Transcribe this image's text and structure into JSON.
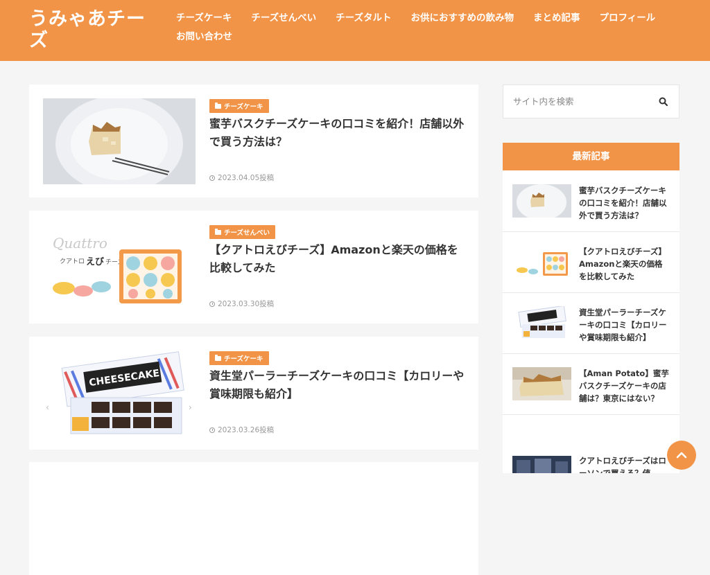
{
  "header": {
    "site_title": "うみゃあチーズ",
    "nav": [
      "チーズケーキ",
      "チーズせんべい",
      "チーズタルト",
      "お供におすすめの飲み物",
      "まとめ記事",
      "プロフィール",
      "お問い合わせ"
    ]
  },
  "articles": [
    {
      "category": "チーズケーキ",
      "title": "蜜芋バスクチーズケーキの口コミを紹介！店舗以外で買う方法は？",
      "date": "2023.04.05投稿"
    },
    {
      "category": "チーズせんべい",
      "title": "【クアトロえびチーズ】Amazonと楽天の価格を比較してみた",
      "date": "2023.03.30投稿",
      "thumb_text": [
        "Quattro",
        "クアトロ",
        "えび",
        "チーズ"
      ]
    },
    {
      "category": "チーズケーキ",
      "title": "資生堂パーラーチーズケーキの口コミ【カロリーや賞味期限も紹介】",
      "date": "2023.03.26投稿",
      "thumb_text": [
        "CHEESECAKE"
      ]
    }
  ],
  "sidebar": {
    "search_placeholder": "サイト内を検索",
    "search_icon": "search-icon",
    "latest_heading": "最新記事",
    "latest": [
      "蜜芋バスクチーズケーキの口コミを紹介！店舗以外で買う方法は？",
      "【クアトロえびチーズ】Amazonと楽天の価格を比較してみた",
      "資生堂パーラーチーズケーキの口コミ【カロリーや賞味期限も紹介】",
      "【Aman Potato】蜜芋バスクチーズケーキの店舗は？東京にはない？",
      "クアトロえびチーズはローソンで買える？値"
    ]
  },
  "colors": {
    "accent": "#f29447",
    "background": "#f5f5f5"
  },
  "icons": {
    "scroll_top": "chevron-up-icon",
    "category": "folder-icon",
    "date": "clock-icon"
  }
}
